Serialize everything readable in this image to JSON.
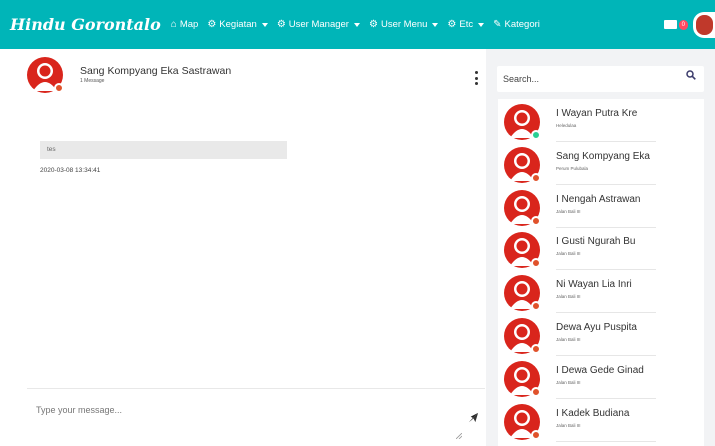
{
  "navbar": {
    "brand": "Hindu Gorontalo",
    "items": [
      {
        "label": "Map",
        "icon": "home-icon",
        "dropdown": false
      },
      {
        "label": "Kegiatan",
        "icon": "gear-icon",
        "dropdown": true
      },
      {
        "label": "User Manager",
        "icon": "gear-icon",
        "dropdown": true
      },
      {
        "label": "User Menu",
        "icon": "gear-icon",
        "dropdown": true
      },
      {
        "label": "Etc",
        "icon": "gear-icon",
        "dropdown": true
      },
      {
        "label": "Kategori",
        "icon": "edit-icon",
        "dropdown": false
      }
    ],
    "mail_badge": "0",
    "colors": {
      "bar": "#00b5b8",
      "badge": "#ff4961"
    }
  },
  "chat": {
    "contact_name": "Sang Kompyang Eka Sastrawan",
    "subtitle": "1 Message",
    "messages": [
      {
        "text": "tes",
        "time": "2020-03-08 13:34:41"
      }
    ],
    "input_placeholder": "Type your message..."
  },
  "contacts": {
    "search_placeholder": "Search...",
    "items": [
      {
        "name": "I Wayan Putra Kre",
        "sub": "Heledulaa",
        "status": "online"
      },
      {
        "name": "Sang Kompyang Eka",
        "sub": "Perum Pulubala",
        "status": "busy"
      },
      {
        "name": "I Nengah Astrawan",
        "sub": "Jalan Bali III",
        "status": "busy"
      },
      {
        "name": "I Gusti Ngurah Bu",
        "sub": "Jalan Bali III",
        "status": "busy"
      },
      {
        "name": "Ni Wayan Lia Inri",
        "sub": "Jalan Bali III",
        "status": "busy"
      },
      {
        "name": "Dewa Ayu Puspita",
        "sub": "Jalan Bali III",
        "status": "busy"
      },
      {
        "name": "I Dewa Gede Ginad",
        "sub": "Jalan Bali III",
        "status": "busy"
      },
      {
        "name": "I Kadek Budiana",
        "sub": "Jalan Bali III",
        "status": "busy"
      }
    ],
    "status_colors": {
      "online": "#28d094",
      "busy": "#e0522b"
    }
  }
}
